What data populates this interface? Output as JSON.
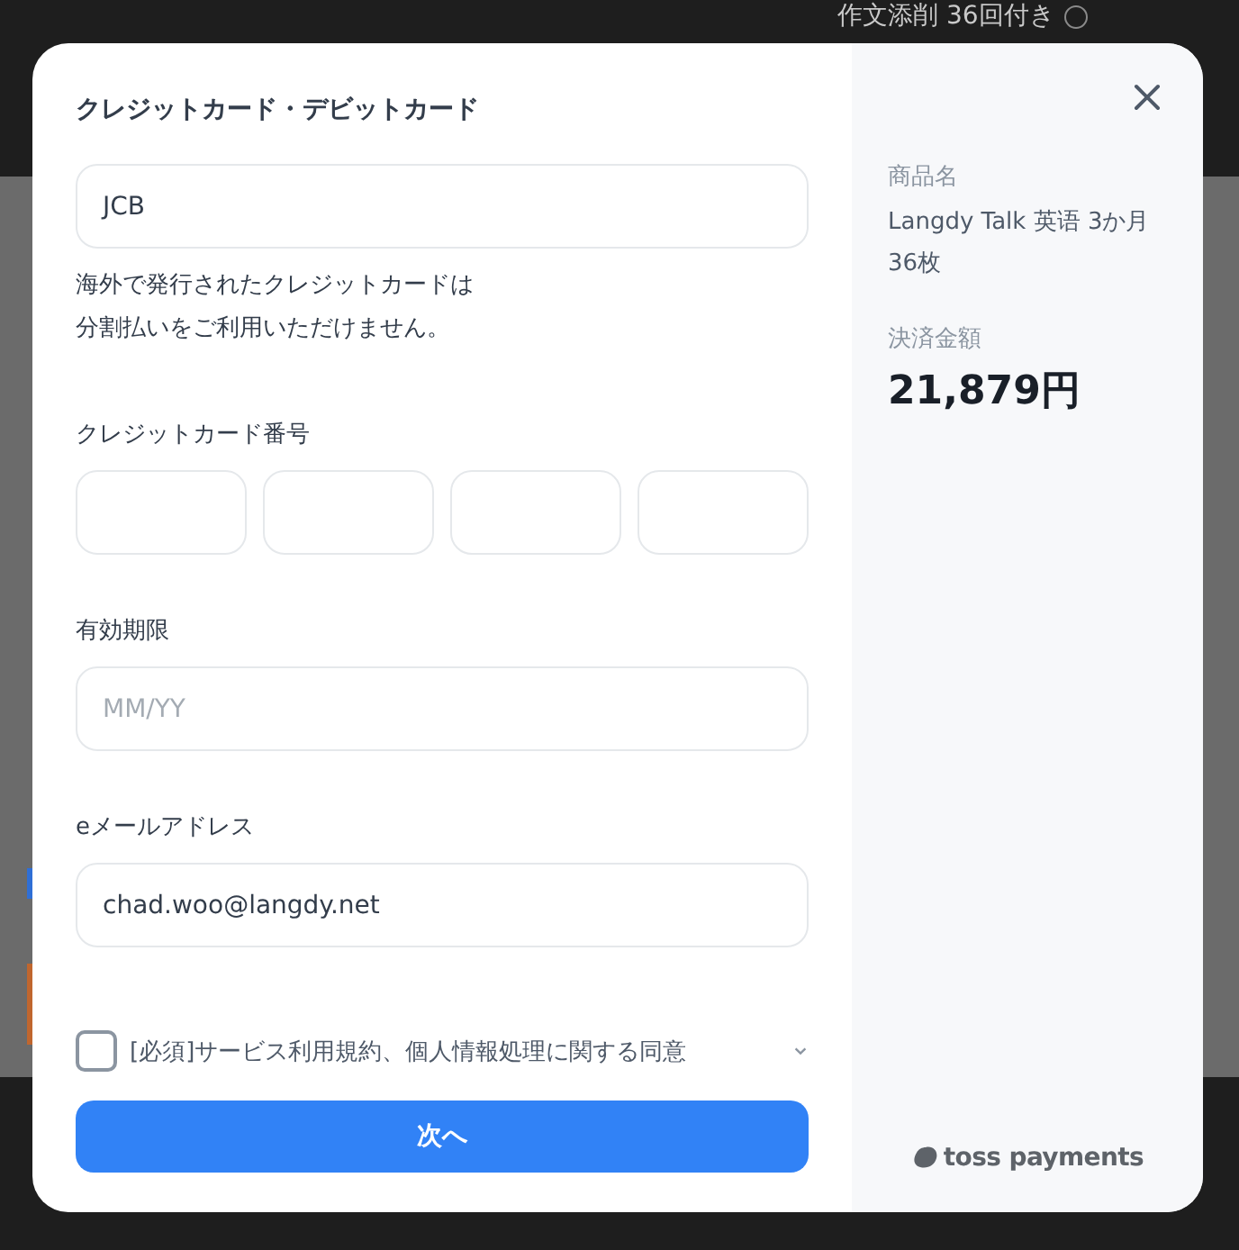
{
  "background": {
    "text": "作文添削 36回付き"
  },
  "form": {
    "title": "クレジットカード・デビットカード",
    "card_company": {
      "value": "JCB"
    },
    "notice": [
      "海外で発行されたクレジットカードは",
      "分割払いをご利用いただけません。"
    ],
    "card_number": {
      "label": "クレジットカード番号",
      "fields": [
        {
          "kind": "digits"
        },
        {
          "kind": "digits"
        },
        {
          "kind": "digits"
        },
        {
          "kind": "digits"
        }
      ]
    },
    "expiry": {
      "label": "有効期限",
      "placeholder": "MM/YY"
    },
    "email": {
      "label": "eメールアドレス",
      "value": "chad.woo@langdy.net"
    },
    "agreement": {
      "label": "[必須]サービス利用規約、個人情報処理に関する同意",
      "checked": false
    },
    "submit": "次へ"
  },
  "summary": {
    "product_label": "商品名",
    "product": [
      "Langdy Talk 英语 3か月",
      "36枚"
    ],
    "amount_label": "決済金額",
    "amount": "21,879円",
    "provider": "toss payments"
  }
}
